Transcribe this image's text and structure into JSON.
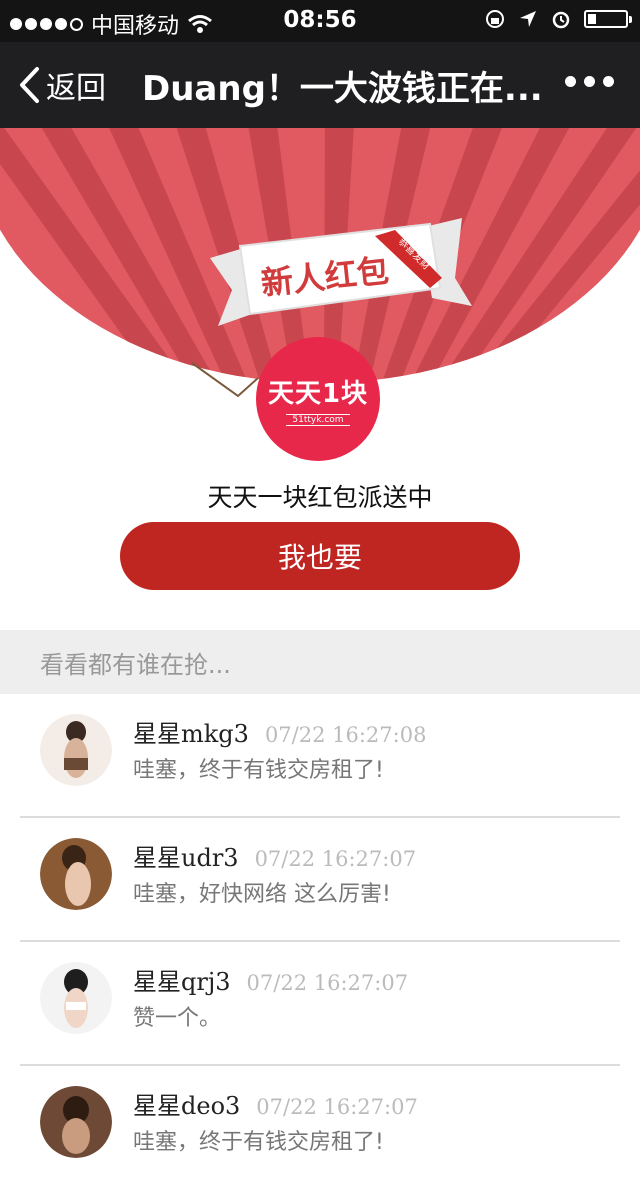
{
  "status_bar": {
    "carrier": "中国移动",
    "time": "08:56"
  },
  "nav": {
    "back_label": "返回",
    "title": "Duang！一大波钱正在..."
  },
  "hero": {
    "banner_text": "新人红包",
    "ribbon_tag": "恭喜发财",
    "logo_text": "天天1块",
    "logo_domain": "51ttyk.com"
  },
  "headline": "天天一块红包派送中",
  "cta_label": "我也要",
  "section_title": "看看都有谁在抢...",
  "feed": [
    {
      "name": "星星mkg3",
      "time": "07/22 16:27:08",
      "message": "哇塞，终于有钱交房租了!"
    },
    {
      "name": "星星udr3",
      "time": "07/22 16:27:07",
      "message": "哇塞，好快网络 这么厉害!"
    },
    {
      "name": "星星qrj3",
      "time": "07/22 16:27:07",
      "message": "赞一个。"
    },
    {
      "name": "星星deo3",
      "time": "07/22 16:27:07",
      "message": "哇塞，终于有钱交房租了!"
    }
  ],
  "colors": {
    "accent_red": "#bf2521",
    "logo_pink": "#e8284a",
    "stripe_light": "#e25a61",
    "stripe_dark": "#c8464d"
  }
}
